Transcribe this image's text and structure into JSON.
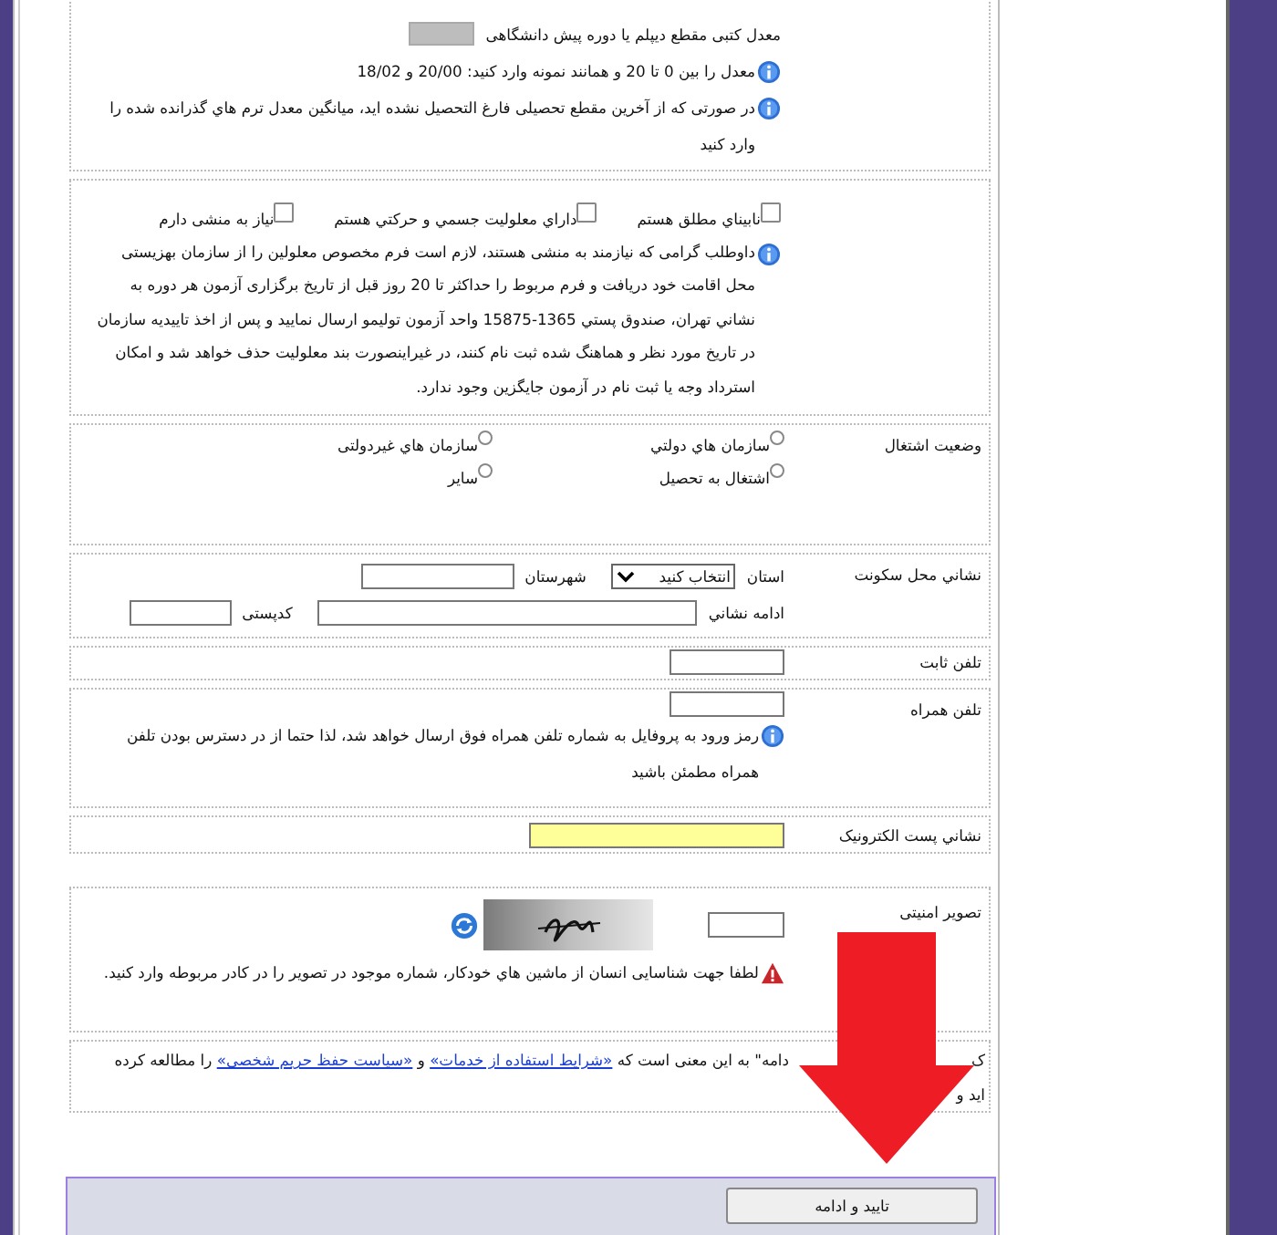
{
  "gpa": {
    "label": "معدل کتبی مقطع دیپلم یا دوره پیش دانشگاهی",
    "field_disabled": true,
    "hints": [
      "معدل را بین 0 تا 20 و همانند نمونه وارد کنید: 20/00 و 18/02",
      "در صورتی که از آخرین مقطع تحصیلی فارغ التحصیل نشده اید، میانگین معدل ترم هاي گذرانده شده را وارد کنید"
    ]
  },
  "disability": {
    "options": [
      {
        "label": "نابيناي مطلق هستم",
        "checked": false
      },
      {
        "label": "داراي معلوليت جسمي و حرکتي هستم",
        "checked": false
      },
      {
        "label": "نیاز به منشی دارم",
        "checked": false
      }
    ],
    "note": "داوطلب گرامی که نیازمند به منشی هستند، لازم است فرم مخصوص معلولین را از سازمان بهزیستی محل اقامت خود دریافت و فرم مربوط را حداکثر تا 20 روز قبل از تاریخ برگزاری آزمون هر دوره به نشاني تهران، صندوق پستي 1365-15875 واحد آزمون توليمو ارسال نمایید و پس از اخذ تاییدیه سازمان در تاریخ مورد نظر و هماهنگ شده ثبت نام کنند، در غیراینصورت بند معلولیت حذف خواهد شد و امکان استرداد وجه یا ثبت نام در آزمون جایگزین وجود ندارد."
  },
  "employment": {
    "label": "وضعیت اشتغال",
    "options": [
      {
        "label": "سازمان هاي دولتي",
        "selected": false
      },
      {
        "label": "سازمان هاي غیردولتی",
        "selected": false
      },
      {
        "label": "اشتغال به تحصیل",
        "selected": false
      },
      {
        "label": "سایر",
        "selected": false
      }
    ]
  },
  "address": {
    "label": "نشاني محل سکونت",
    "province_label": "استان",
    "province_value": "انتخاب کنید",
    "city_label": "شهرستان",
    "street_label": "ادامه نشاني",
    "postal_code_label": "کدپستی"
  },
  "landline": {
    "label": "تلفن ثابت"
  },
  "mobile": {
    "label": "تلفن همراه",
    "note": "رمز ورود به پروفایل به شماره تلفن همراه فوق ارسال خواهد شد، لذا حتما از در دسترس بودن تلفن همراه مطمئن باشید"
  },
  "email": {
    "label": "نشاني پست الکترونیک",
    "highlighted": true
  },
  "captcha": {
    "label": "تصویر امنیتی",
    "warning": "لطفا جهت شناسایی انسان از ماشین هاي خودکار، شماره موجود در تصویر را در کادر مربوطه وارد کنید."
  },
  "terms": {
    "start": "ک",
    "text_1": "دامه\" به این معنی است که",
    "link_1": "«شرایط استفاده از خدمات»",
    "text_2": "و",
    "link_2": "«سیاست حفظ حریم شخصی»",
    "text_3": "را مطالعه کرده",
    "text_4": "اید و"
  },
  "submit_button": "تایید و ادامه"
}
